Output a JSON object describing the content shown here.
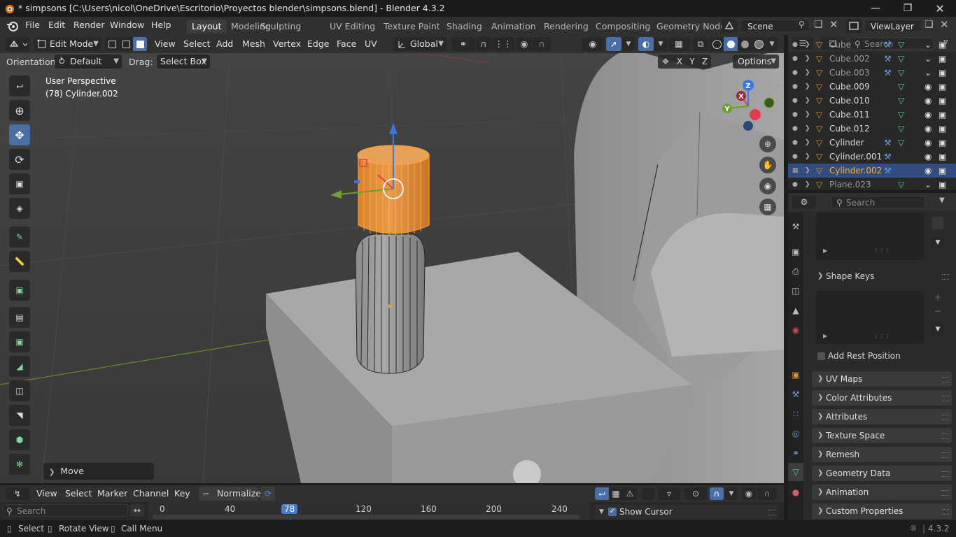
{
  "window": {
    "title": "* simpsons [C:\\Users\\nicol\\OneDrive\\Escritorio\\Proyectos blender\\simpsons.blend] - Blender 4.3.2"
  },
  "menubar": {
    "items": [
      "File",
      "Edit",
      "Render",
      "Window",
      "Help"
    ],
    "workspaces": [
      "Layout",
      "Modeling",
      "Sculpting",
      "UV Editing",
      "Texture Paint",
      "Shading",
      "Animation",
      "Rendering",
      "Compositing",
      "Geometry Node"
    ],
    "active_workspace": "Layout",
    "scene": "Scene",
    "view_layer": "ViewLayer"
  },
  "viewport_header": {
    "mode": "Edit Mode",
    "menus": [
      "View",
      "Select",
      "Add",
      "Mesh",
      "Vertex",
      "Edge",
      "Face",
      "UV"
    ],
    "transform_orientation": "Global"
  },
  "tool_settings": {
    "orientation_label": "Orientation:",
    "orientation_value": "Default",
    "drag_label": "Drag:",
    "drag_value": "Select Box",
    "axes": [
      "X",
      "Y",
      "Z"
    ],
    "options_label": "Options"
  },
  "viewport": {
    "view_name": "User Perspective",
    "object_info": "(78) Cylinder.002",
    "last_operator": "Move",
    "gizmo_axes": [
      "Z",
      "X",
      "Y"
    ]
  },
  "outliner": {
    "search_placeholder": "Search",
    "rows": [
      {
        "name": "Cube",
        "dim": true
      },
      {
        "name": "Cube.002",
        "dim": true
      },
      {
        "name": "Cube.003",
        "dim": true
      },
      {
        "name": "Cube.009",
        "dim": false
      },
      {
        "name": "Cube.010",
        "dim": false
      },
      {
        "name": "Cube.011",
        "dim": false
      },
      {
        "name": "Cube.012",
        "dim": false
      },
      {
        "name": "Cylinder",
        "dim": false
      },
      {
        "name": "Cylinder.001",
        "dim": false
      },
      {
        "name": "Cylinder.002",
        "dim": false,
        "selected": true
      },
      {
        "name": "Plane.023",
        "dim": true
      }
    ]
  },
  "properties": {
    "search_placeholder": "Search",
    "shape_keys_label": "Shape Keys",
    "add_rest_position_label": "Add Rest Position",
    "panels": [
      "UV Maps",
      "Color Attributes",
      "Attributes",
      "Texture Space",
      "Remesh",
      "Geometry Data",
      "Animation",
      "Custom Properties"
    ]
  },
  "timeline": {
    "menus": [
      "View",
      "Select",
      "Marker",
      "Channel",
      "Key"
    ],
    "normalize_label": "Normalize",
    "search_placeholder": "Search",
    "ruler_labels": [
      "0",
      "40",
      "78",
      "120",
      "160",
      "200",
      "240"
    ],
    "current_frame": "78",
    "show_cursor_label": "Show Cursor"
  },
  "statusbar": {
    "hints": [
      "Select",
      "Rotate View",
      "Call Menu"
    ],
    "version": "4.3.2"
  },
  "colors": {
    "accent_blue": "#4a6fa6",
    "selection_orange": "#ff9d2c",
    "outliner_selected_text": "#ffaf29",
    "gizmo_x": "#e13c50",
    "gizmo_y": "#6aa22b",
    "gizmo_z": "#3b78e6"
  }
}
